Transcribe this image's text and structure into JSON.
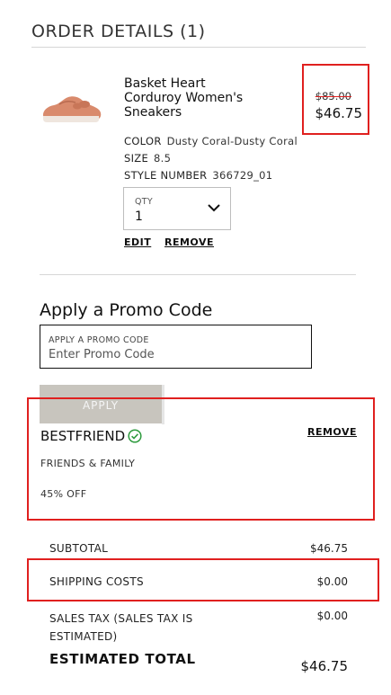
{
  "order": {
    "title": "ORDER DETAILS (1)",
    "item": {
      "name_line1": "Basket Heart",
      "name_line2": "Corduroy Women's",
      "name_line3": "Sneakers",
      "original_price": "$85.00",
      "sale_price": "$46.75",
      "color_label": "COLOR",
      "color_value": "Dusty Coral-Dusty Coral",
      "size_label": "SIZE",
      "size_value": "8.5",
      "style_label": "STYLE NUMBER",
      "style_value": "366729_01",
      "qty_label": "QTY",
      "qty_value": "1",
      "edit_label": "EDIT",
      "remove_label": "REMOVE"
    }
  },
  "promo": {
    "heading": "Apply a Promo Code",
    "input_label": "APPLY A PROMO CODE",
    "input_placeholder": "Enter Promo Code",
    "apply_label": "APPLY",
    "applied_code": "BESTFRIEND",
    "remove_label": "REMOVE",
    "description": "FRIENDS & FAMILY",
    "discount": "45% OFF"
  },
  "summary": {
    "subtotal_label": "SUBTOTAL",
    "subtotal_value": "$46.75",
    "shipping_label": "SHIPPING COSTS",
    "shipping_value": "$0.00",
    "tax_label_line1": "SALES TAX (SALES TAX IS",
    "tax_label_line2": "ESTIMATED)",
    "tax_value": "$0.00",
    "total_label": "ESTIMATED TOTAL",
    "total_value": "$46.75"
  },
  "colors": {
    "highlight": "#e0201f",
    "apply_button": "#c8c5be",
    "success": "#2e9b3e",
    "shoe": "#d98a6c"
  }
}
